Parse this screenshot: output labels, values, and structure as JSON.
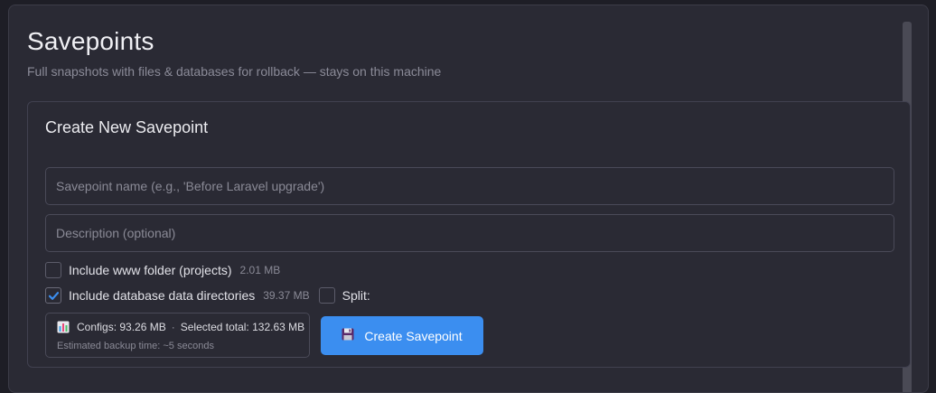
{
  "header": {
    "title": "Savepoints",
    "subtitle": "Full snapshots with files & databases for rollback — stays on this machine"
  },
  "create_card": {
    "title": "Create New Savepoint",
    "name_field": {
      "value": "",
      "placeholder": "Savepoint name (e.g., 'Before Laravel upgrade')"
    },
    "description_field": {
      "value": "",
      "placeholder": "Description (optional)"
    },
    "include_www": {
      "label": "Include www folder (projects)",
      "size": "2.01 MB",
      "checked": false
    },
    "include_db": {
      "label": "Include database data directories",
      "size": "39.37 MB",
      "checked": true
    },
    "split": {
      "label": "Split:",
      "checked": false
    },
    "summary": {
      "icon": "bar-chart-icon",
      "configs": "Configs: 93.26 MB",
      "separator": "·",
      "selected_total": "Selected total: 132.63 MB",
      "estimate": "Estimated backup time: ~5 seconds"
    },
    "create_button": {
      "icon": "floppy-disk-icon",
      "label": "Create Savepoint"
    }
  },
  "colors": {
    "background": "#2a2a34",
    "accent": "#3b8ef0",
    "checkmark": "#3b8ef0",
    "muted_text": "#8a8a96"
  }
}
